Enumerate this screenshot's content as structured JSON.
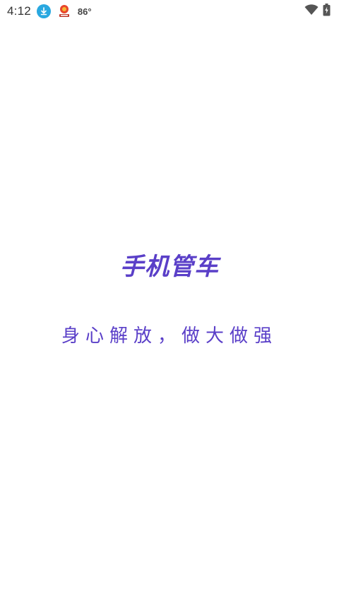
{
  "status_bar": {
    "time": "4:12",
    "temperature": "86°",
    "icons": {
      "download": "download-icon",
      "app": "app-notification-icon",
      "wifi": "wifi-icon",
      "battery": "battery-charging-icon"
    },
    "colors": {
      "download_bg": "#29a8e0",
      "icon_dark": "#555555"
    }
  },
  "splash": {
    "title": "手机管车",
    "slogan": "身心解放，做大做强",
    "accent_color": "#5a3fc8"
  }
}
